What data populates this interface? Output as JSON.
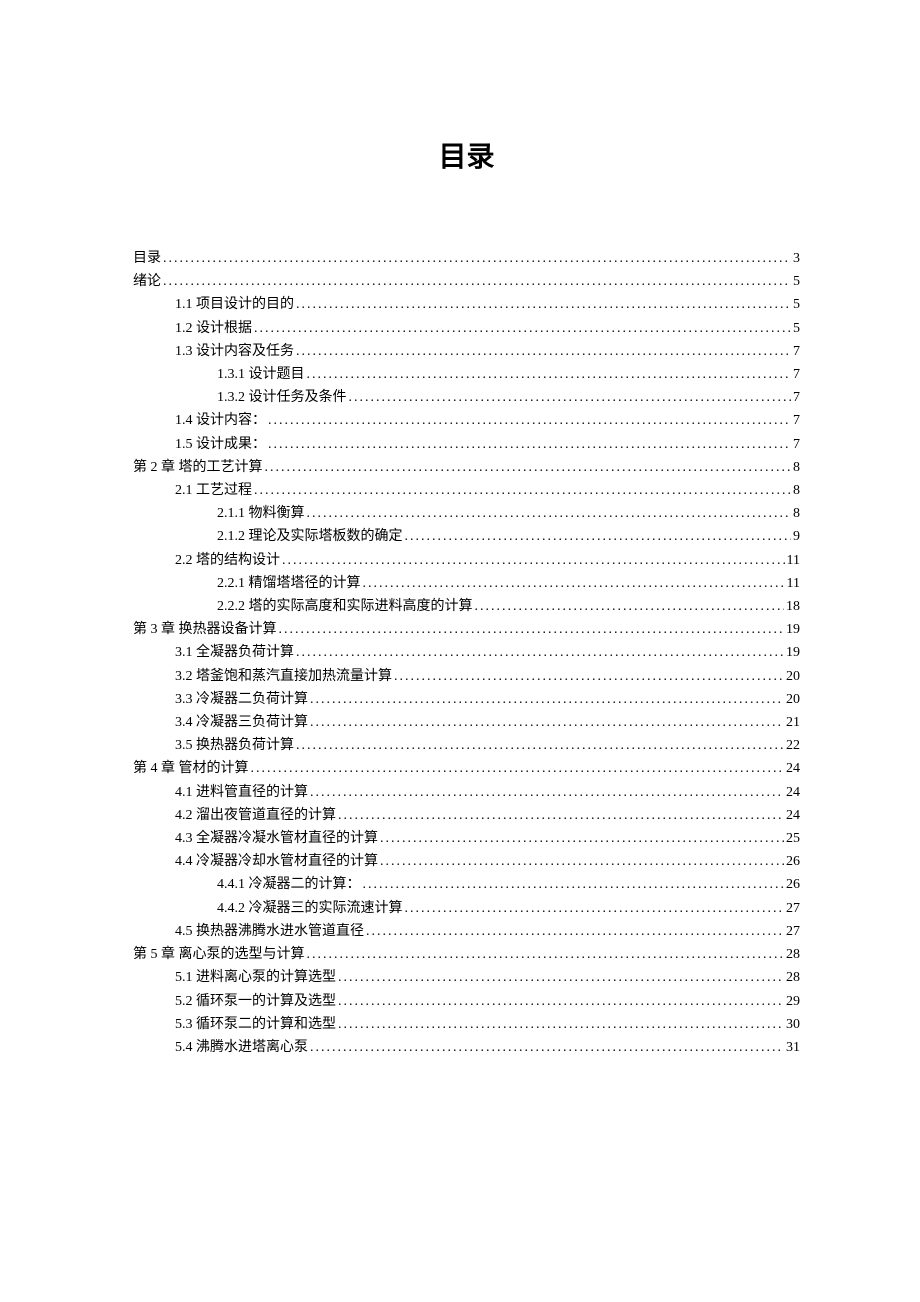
{
  "title": "目录",
  "entries": [
    {
      "level": 0,
      "label": "目录",
      "page": "3"
    },
    {
      "level": 0,
      "label": "绪论",
      "page": "5"
    },
    {
      "level": 1,
      "label": "1.1 项目设计的目的",
      "page": "5"
    },
    {
      "level": 1,
      "label": "1.2 设计根据",
      "page": "5"
    },
    {
      "level": 1,
      "label": "1.3 设计内容及任务",
      "page": "7"
    },
    {
      "level": 2,
      "label": "1.3.1 设计题目",
      "page": "7"
    },
    {
      "level": 2,
      "label": "1.3.2 设计任务及条件",
      "page": "7"
    },
    {
      "level": 1,
      "label": "1.4 设计内容：",
      "page": "7"
    },
    {
      "level": 1,
      "label": "1.5 设计成果：",
      "page": "7"
    },
    {
      "level": 0,
      "label": "第 2 章 塔的工艺计算",
      "page": "8"
    },
    {
      "level": 1,
      "label": "2.1 工艺过程",
      "page": "8"
    },
    {
      "level": 2,
      "label": "2.1.1 物料衡算",
      "page": "8"
    },
    {
      "level": 2,
      "label": "2.1.2 理论及实际塔板数的确定",
      "page": "9"
    },
    {
      "level": 1,
      "label": "2.2 塔的结构设计",
      "page": "11"
    },
    {
      "level": 2,
      "label": "2.2.1 精馏塔塔径的计算",
      "page": "11"
    },
    {
      "level": 2,
      "label": "2.2.2 塔的实际高度和实际进料高度的计算",
      "page": "18"
    },
    {
      "level": 0,
      "label": "第 3 章 换热器设备计算",
      "page": "19"
    },
    {
      "level": 1,
      "label": "3.1 全凝器负荷计算",
      "page": "19"
    },
    {
      "level": 1,
      "label": "3.2 塔釜饱和蒸汽直接加热流量计算",
      "page": "20"
    },
    {
      "level": 1,
      "label": "3.3 冷凝器二负荷计算",
      "page": "20"
    },
    {
      "level": 1,
      "label": "3.4 冷凝器三负荷计算",
      "page": "21"
    },
    {
      "level": 1,
      "label": "3.5 换热器负荷计算",
      "page": "22"
    },
    {
      "level": 0,
      "label": "第 4 章 管材的计算",
      "page": "24"
    },
    {
      "level": 1,
      "label": "4.1 进料管直径的计算",
      "page": "24"
    },
    {
      "level": 1,
      "label": "4.2 溜出夜管道直径的计算",
      "page": "24"
    },
    {
      "level": 1,
      "label": "4.3 全凝器冷凝水管材直径的计算",
      "page": "25"
    },
    {
      "level": 1,
      "label": "4.4 冷凝器冷却水管材直径的计算",
      "page": "26"
    },
    {
      "level": 2,
      "label": "4.4.1 冷凝器二的计算：",
      "page": "26"
    },
    {
      "level": 2,
      "label": "4.4.2 冷凝器三的实际流速计算",
      "page": "27"
    },
    {
      "level": 1,
      "label": "4.5 换热器沸腾水进水管道直径",
      "page": "27"
    },
    {
      "level": 0,
      "label": "第 5 章 离心泵的选型与计算",
      "page": "28"
    },
    {
      "level": 1,
      "label": "5.1 进料离心泵的计算选型",
      "page": "28"
    },
    {
      "level": 1,
      "label": "5.2 循环泵一的计算及选型",
      "page": "29"
    },
    {
      "level": 1,
      "label": "5.3 循环泵二的计算和选型",
      "page": "30"
    },
    {
      "level": 1,
      "label": "5.4 沸腾水进塔离心泵",
      "page": "31"
    }
  ]
}
